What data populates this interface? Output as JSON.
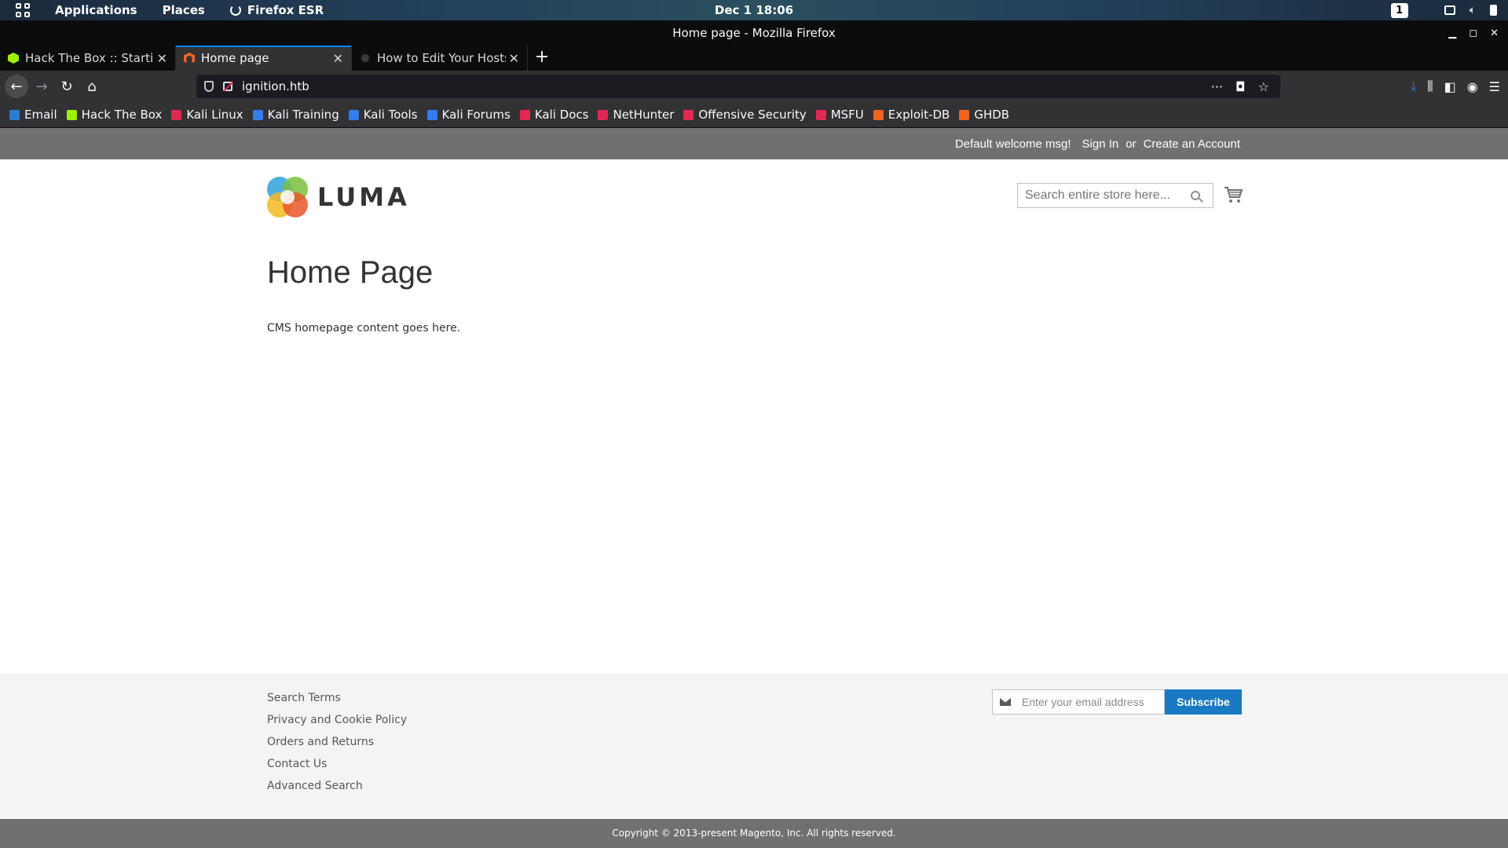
{
  "gnome_panel": {
    "applications": "Applications",
    "places": "Places",
    "active_app": "Firefox ESR",
    "clock": "Dec 1  18:06",
    "workspace": "1"
  },
  "window": {
    "title": "Home page - Mozilla Firefox"
  },
  "tabs": [
    {
      "label": "Hack The Box :: Starting Point",
      "favicon": "hackthebox-icon",
      "active": false
    },
    {
      "label": "Home page",
      "favicon": "magento-icon",
      "active": true
    },
    {
      "label": "How to Edit Your Hosts File",
      "favicon": "site-icon",
      "active": false
    }
  ],
  "navbar": {
    "url": "ignition.htb"
  },
  "bookmarks": [
    {
      "label": "Email",
      "color": "#2b7cd3"
    },
    {
      "label": "Hack The Box",
      "color": "#9fef00"
    },
    {
      "label": "Kali Linux",
      "color": "#e22850"
    },
    {
      "label": "Kali Training",
      "color": "#367bf0"
    },
    {
      "label": "Kali Tools",
      "color": "#367bf0"
    },
    {
      "label": "Kali Forums",
      "color": "#367bf0"
    },
    {
      "label": "Kali Docs",
      "color": "#e22850"
    },
    {
      "label": "NetHunter",
      "color": "#e22850"
    },
    {
      "label": "Offensive Security",
      "color": "#e22850"
    },
    {
      "label": "MSFU",
      "color": "#e22850"
    },
    {
      "label": "Exploit-DB",
      "color": "#f26322"
    },
    {
      "label": "GHDB",
      "color": "#f26322"
    }
  ],
  "store": {
    "welcome": "Default welcome msg!",
    "sign_in": "Sign In",
    "or": "or",
    "create_account": "Create an Account",
    "logo_text": "LUMA",
    "search_placeholder": "Search entire store here...",
    "page_title": "Home Page",
    "page_content": "CMS homepage content goes here.",
    "footer_links": [
      "Search Terms",
      "Privacy and Cookie Policy",
      "Orders and Returns",
      "Contact Us",
      "Advanced Search"
    ],
    "newsletter_placeholder": "Enter your email address",
    "subscribe": "Subscribe",
    "copyright": "Copyright © 2013-present Magento, Inc. All rights reserved."
  }
}
